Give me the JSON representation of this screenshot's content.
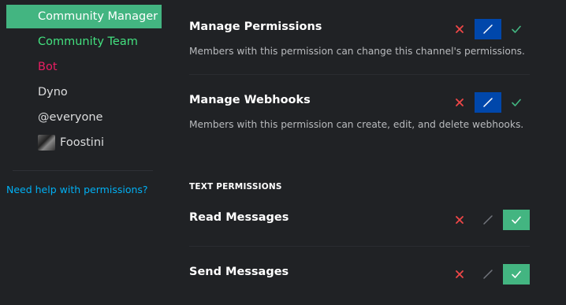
{
  "sidebar": {
    "roles": [
      {
        "label": "Community Manager",
        "color": "#ffffff",
        "selected": true
      },
      {
        "label": "Community Team",
        "color": "#43e07f",
        "selected": false
      },
      {
        "label": "Bot",
        "color": "#e91e63",
        "selected": false
      },
      {
        "label": "Dyno",
        "color": "#dcddde",
        "selected": false
      },
      {
        "label": "@everyone",
        "color": "#dcddde",
        "selected": false
      }
    ],
    "member": {
      "label": "Foostini"
    },
    "help_link": "Need help with permissions?"
  },
  "permissions": [
    {
      "title": "Manage Permissions",
      "description": "Members with this permission can change this channel's permissions.",
      "state": "neutral"
    },
    {
      "title": "Manage Webhooks",
      "description": "Members with this permission can create, edit, and delete webhooks.",
      "state": "neutral"
    }
  ],
  "text_permissions": {
    "header": "TEXT PERMISSIONS",
    "items": [
      {
        "title": "Read Messages",
        "state": "allow"
      },
      {
        "title": "Send Messages",
        "state": "allow"
      }
    ]
  },
  "colors": {
    "selected_role_bg": "#43b581",
    "neutral_active": "#0047ab",
    "allow_active": "#43b581",
    "deny_icon": "#f04747",
    "allow_icon": "#43b581",
    "link": "#00b0f4"
  },
  "icons": {
    "deny": "x-icon",
    "neutral": "slash-icon",
    "allow": "check-icon"
  }
}
